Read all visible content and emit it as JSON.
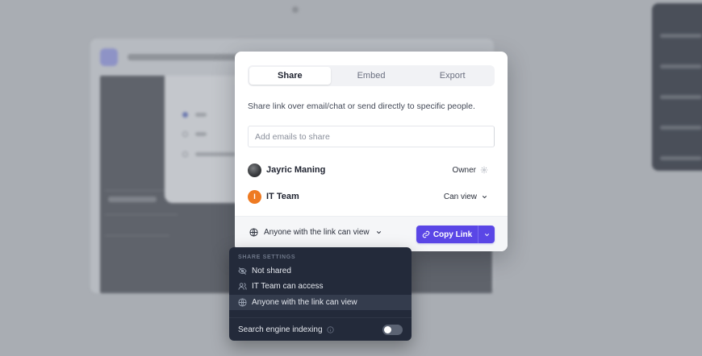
{
  "share_modal": {
    "tabs": [
      {
        "label": "Share",
        "active": true
      },
      {
        "label": "Embed",
        "active": false
      },
      {
        "label": "Export",
        "active": false
      }
    ],
    "description": "Share link over email/chat or send directly to specific people.",
    "email_input": {
      "placeholder": "Add emails to share",
      "value": ""
    },
    "members": [
      {
        "name": "Jayric Maning",
        "role": "Owner",
        "role_icon": "gear-icon",
        "avatar": "photo"
      },
      {
        "name": "IT Team",
        "role": "Can view",
        "role_icon": "chevron-down-icon",
        "avatar_letter": "I",
        "avatar_color": "#ee7a22"
      }
    ],
    "link_access": {
      "label": "Anyone with the link can view",
      "icon": "globe-icon"
    },
    "copy_link": {
      "label": "Copy Link",
      "icon": "link-icon",
      "color": "#5a46e6"
    }
  },
  "share_settings_menu": {
    "heading": "SHARE SETTINGS",
    "options": [
      {
        "label": "Not shared",
        "icon": "eye-off-icon",
        "selected": false
      },
      {
        "label": "IT Team can access",
        "icon": "users-icon",
        "selected": false
      },
      {
        "label": "Anyone with the link can view",
        "icon": "globe-icon",
        "selected": true
      }
    ],
    "search_indexing": {
      "label": "Search engine indexing",
      "icon": "info-icon",
      "enabled": false
    }
  }
}
